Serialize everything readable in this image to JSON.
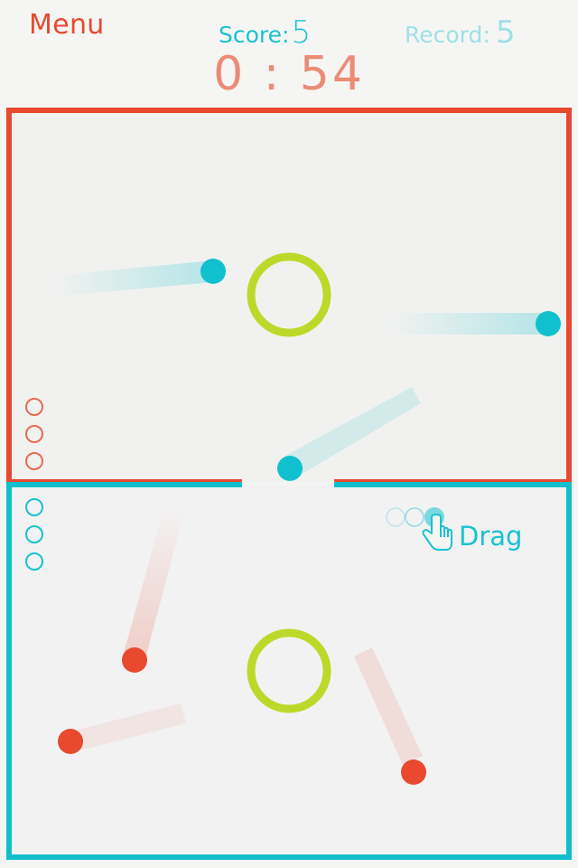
{
  "hud": {
    "menu_label": "Menu",
    "score_label": "Score:",
    "score_value": "5",
    "record_label": "Record:",
    "record_value": "5",
    "timer": "0 : 54"
  },
  "hint": {
    "drag_label": "Drag",
    "icon": "hand-pointer-icon"
  },
  "lives": {
    "red_remaining": 3,
    "blue_remaining": 3
  },
  "colors": {
    "red": "#e8492f",
    "blue": "#19c2d0",
    "ring": "#bcd92a",
    "background": "#f5f6f4"
  }
}
